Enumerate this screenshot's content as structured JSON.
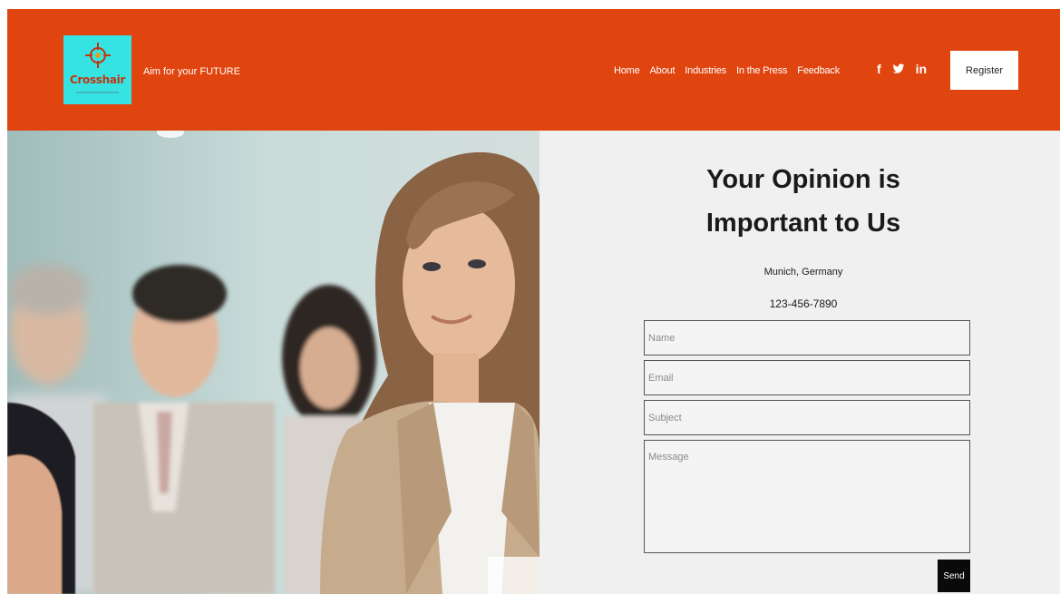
{
  "brand": {
    "logo_text": "Crosshair",
    "tagline": "Aim for your FUTURE"
  },
  "nav": {
    "items": [
      "Home",
      "About",
      "Industries",
      "In the Press",
      "Feedback"
    ]
  },
  "social": {
    "icons": [
      "facebook-icon",
      "twitter-icon",
      "linkedin-icon"
    ],
    "facebook": "f",
    "twitter": "🐦",
    "linkedin": "in"
  },
  "header": {
    "register_label": "Register",
    "background": "#e0450f"
  },
  "contact": {
    "title_line1": "Your Opinion is",
    "title_line2": "Important to Us",
    "address": "Munich, Germany",
    "phone": "123-456-7890",
    "name_placeholder": "Name",
    "email_placeholder": "Email",
    "subject_placeholder": "Subject",
    "message_placeholder": "Message",
    "send_label": "Send"
  },
  "colors": {
    "accent": "#e0450f",
    "logo_bg": "#35e3e3",
    "panel_bg": "#f0f0f0"
  }
}
